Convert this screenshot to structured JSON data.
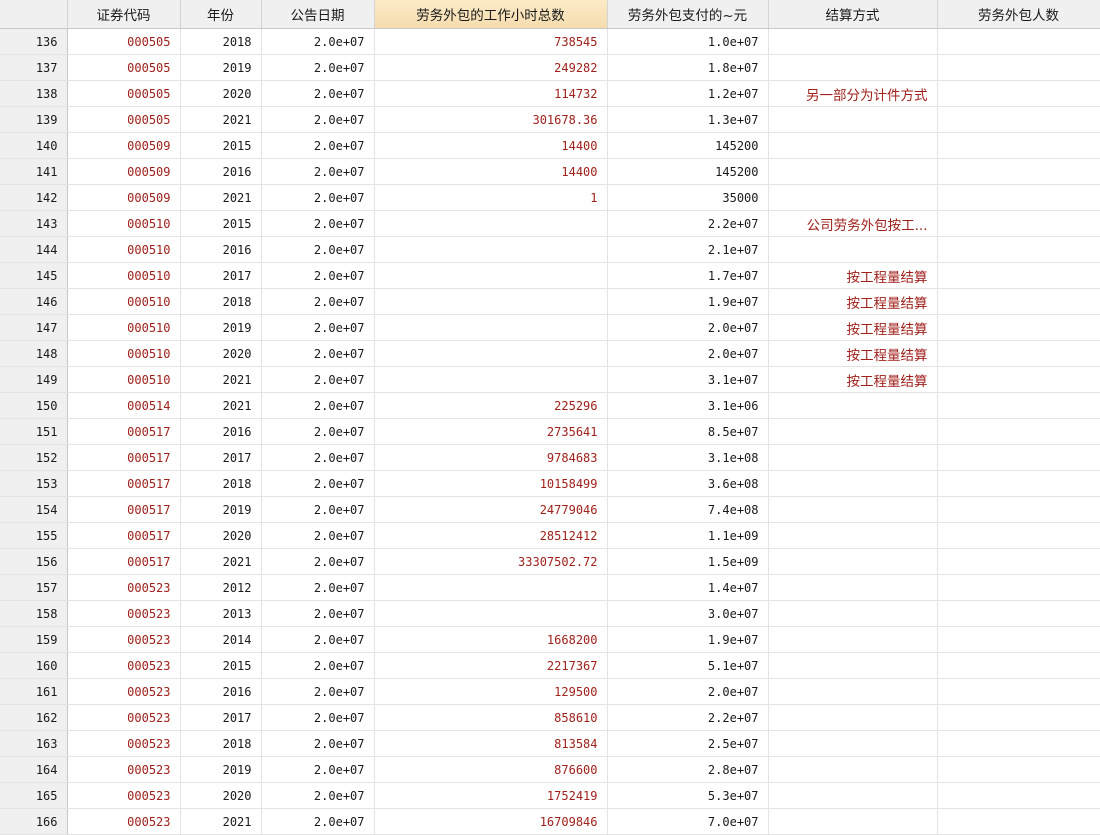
{
  "columns": [
    "证券代码",
    "年份",
    "公告日期",
    "劳务外包的工作小时总数",
    "劳务外包支付的~元",
    "结算方式",
    "劳务外包人数"
  ],
  "rows": [
    {
      "n": "136",
      "code": "000505",
      "year": "2018",
      "date": "2.0e+07",
      "hours": "738545",
      "pay": "1.0e+07",
      "settle": "",
      "people": ""
    },
    {
      "n": "137",
      "code": "000505",
      "year": "2019",
      "date": "2.0e+07",
      "hours": "249282",
      "pay": "1.8e+07",
      "settle": "",
      "people": ""
    },
    {
      "n": "138",
      "code": "000505",
      "year": "2020",
      "date": "2.0e+07",
      "hours": "114732",
      "pay": "1.2e+07",
      "settle": "另一部分为计件方式",
      "people": ""
    },
    {
      "n": "139",
      "code": "000505",
      "year": "2021",
      "date": "2.0e+07",
      "hours": "301678.36",
      "pay": "1.3e+07",
      "settle": "",
      "people": ""
    },
    {
      "n": "140",
      "code": "000509",
      "year": "2015",
      "date": "2.0e+07",
      "hours": "14400",
      "pay": "145200",
      "settle": "",
      "people": ""
    },
    {
      "n": "141",
      "code": "000509",
      "year": "2016",
      "date": "2.0e+07",
      "hours": "14400",
      "pay": "145200",
      "settle": "",
      "people": ""
    },
    {
      "n": "142",
      "code": "000509",
      "year": "2021",
      "date": "2.0e+07",
      "hours": "1",
      "pay": "35000",
      "settle": "",
      "people": ""
    },
    {
      "n": "143",
      "code": "000510",
      "year": "2015",
      "date": "2.0e+07",
      "hours": "",
      "pay": "2.2e+07",
      "settle": "公司劳务外包按工...",
      "people": ""
    },
    {
      "n": "144",
      "code": "000510",
      "year": "2016",
      "date": "2.0e+07",
      "hours": "",
      "pay": "2.1e+07",
      "settle": "",
      "people": ""
    },
    {
      "n": "145",
      "code": "000510",
      "year": "2017",
      "date": "2.0e+07",
      "hours": "",
      "pay": "1.7e+07",
      "settle": "按工程量结算",
      "people": ""
    },
    {
      "n": "146",
      "code": "000510",
      "year": "2018",
      "date": "2.0e+07",
      "hours": "",
      "pay": "1.9e+07",
      "settle": "按工程量结算",
      "people": ""
    },
    {
      "n": "147",
      "code": "000510",
      "year": "2019",
      "date": "2.0e+07",
      "hours": "",
      "pay": "2.0e+07",
      "settle": "按工程量结算",
      "people": ""
    },
    {
      "n": "148",
      "code": "000510",
      "year": "2020",
      "date": "2.0e+07",
      "hours": "",
      "pay": "2.0e+07",
      "settle": "按工程量结算",
      "people": ""
    },
    {
      "n": "149",
      "code": "000510",
      "year": "2021",
      "date": "2.0e+07",
      "hours": "",
      "pay": "3.1e+07",
      "settle": "按工程量结算",
      "people": ""
    },
    {
      "n": "150",
      "code": "000514",
      "year": "2021",
      "date": "2.0e+07",
      "hours": "225296",
      "pay": "3.1e+06",
      "settle": "",
      "people": ""
    },
    {
      "n": "151",
      "code": "000517",
      "year": "2016",
      "date": "2.0e+07",
      "hours": "2735641",
      "pay": "8.5e+07",
      "settle": "",
      "people": ""
    },
    {
      "n": "152",
      "code": "000517",
      "year": "2017",
      "date": "2.0e+07",
      "hours": "9784683",
      "pay": "3.1e+08",
      "settle": "",
      "people": ""
    },
    {
      "n": "153",
      "code": "000517",
      "year": "2018",
      "date": "2.0e+07",
      "hours": "10158499",
      "pay": "3.6e+08",
      "settle": "",
      "people": ""
    },
    {
      "n": "154",
      "code": "000517",
      "year": "2019",
      "date": "2.0e+07",
      "hours": "24779046",
      "pay": "7.4e+08",
      "settle": "",
      "people": ""
    },
    {
      "n": "155",
      "code": "000517",
      "year": "2020",
      "date": "2.0e+07",
      "hours": "28512412",
      "pay": "1.1e+09",
      "settle": "",
      "people": ""
    },
    {
      "n": "156",
      "code": "000517",
      "year": "2021",
      "date": "2.0e+07",
      "hours": "33307502.72",
      "pay": "1.5e+09",
      "settle": "",
      "people": ""
    },
    {
      "n": "157",
      "code": "000523",
      "year": "2012",
      "date": "2.0e+07",
      "hours": "",
      "pay": "1.4e+07",
      "settle": "",
      "people": ""
    },
    {
      "n": "158",
      "code": "000523",
      "year": "2013",
      "date": "2.0e+07",
      "hours": "",
      "pay": "3.0e+07",
      "settle": "",
      "people": ""
    },
    {
      "n": "159",
      "code": "000523",
      "year": "2014",
      "date": "2.0e+07",
      "hours": "1668200",
      "pay": "1.9e+07",
      "settle": "",
      "people": ""
    },
    {
      "n": "160",
      "code": "000523",
      "year": "2015",
      "date": "2.0e+07",
      "hours": "2217367",
      "pay": "5.1e+07",
      "settle": "",
      "people": ""
    },
    {
      "n": "161",
      "code": "000523",
      "year": "2016",
      "date": "2.0e+07",
      "hours": "129500",
      "pay": "2.0e+07",
      "settle": "",
      "people": ""
    },
    {
      "n": "162",
      "code": "000523",
      "year": "2017",
      "date": "2.0e+07",
      "hours": "858610",
      "pay": "2.2e+07",
      "settle": "",
      "people": ""
    },
    {
      "n": "163",
      "code": "000523",
      "year": "2018",
      "date": "2.0e+07",
      "hours": "813584",
      "pay": "2.5e+07",
      "settle": "",
      "people": ""
    },
    {
      "n": "164",
      "code": "000523",
      "year": "2019",
      "date": "2.0e+07",
      "hours": "876600",
      "pay": "2.8e+07",
      "settle": "",
      "people": ""
    },
    {
      "n": "165",
      "code": "000523",
      "year": "2020",
      "date": "2.0e+07",
      "hours": "1752419",
      "pay": "5.3e+07",
      "settle": "",
      "people": ""
    },
    {
      "n": "166",
      "code": "000523",
      "year": "2021",
      "date": "2.0e+07",
      "hours": "16709846",
      "pay": "7.0e+07",
      "settle": "",
      "people": ""
    }
  ]
}
